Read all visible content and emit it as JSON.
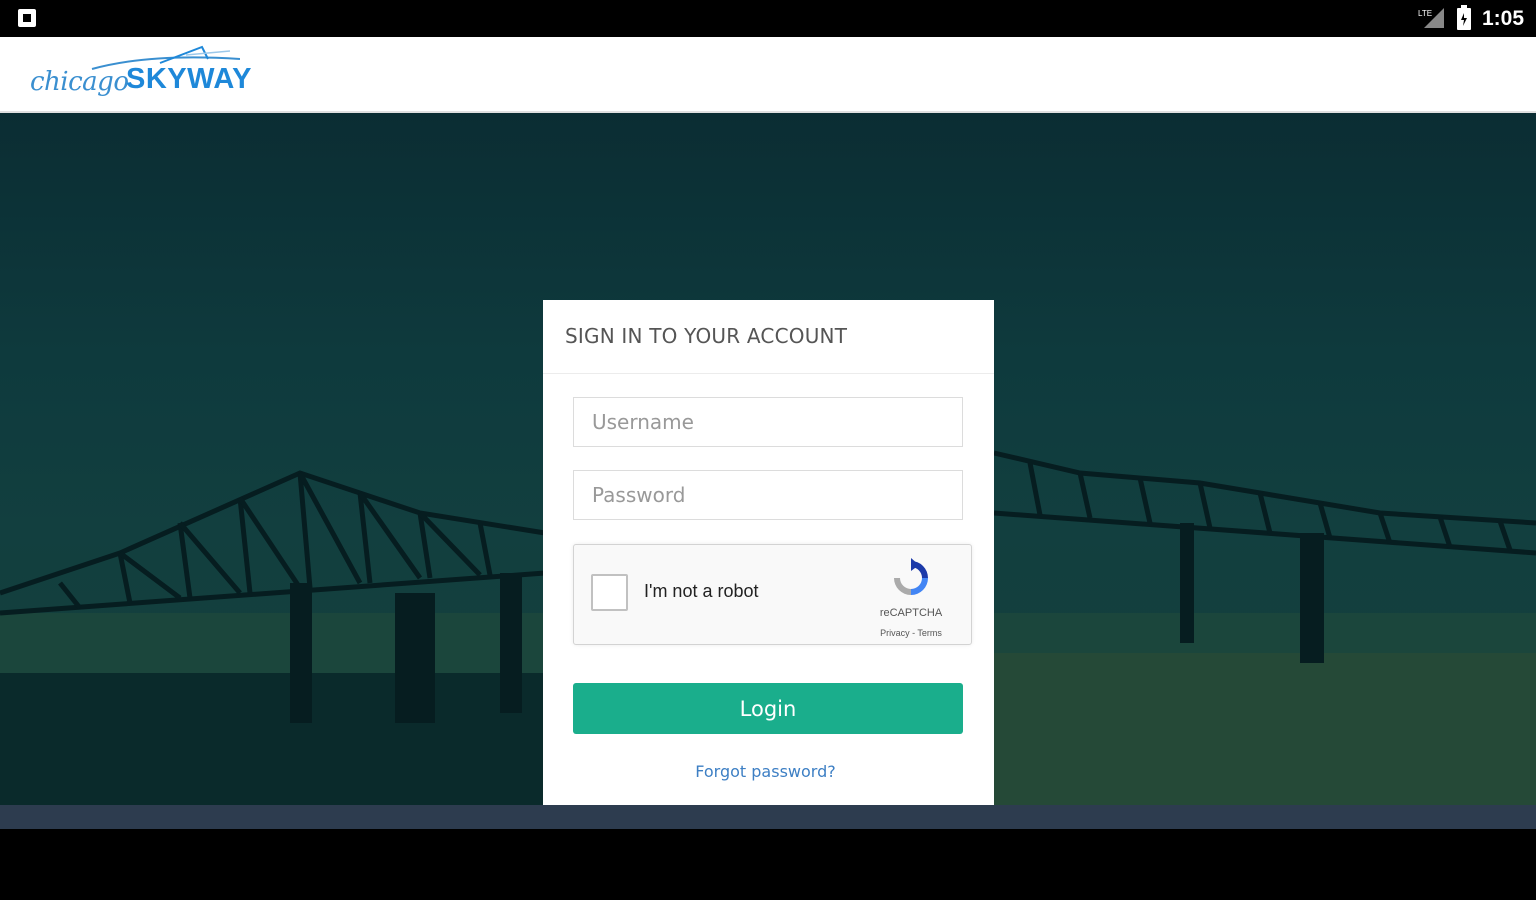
{
  "status_bar": {
    "time": "1:05",
    "left_icon": "notification-icon",
    "signal_icon": "cell-signal-icon",
    "battery_icon": "battery-icon"
  },
  "header": {
    "logo_script": "chicago",
    "logo_bold": "SKYWAY"
  },
  "login": {
    "title": "SIGN IN TO YOUR ACCOUNT",
    "username_placeholder": "Username",
    "password_placeholder": "Password",
    "captcha_label": "I'm not a robot",
    "captcha_brand": "reCAPTCHA",
    "captcha_links": "Privacy - Terms",
    "login_button": "Login",
    "forgot_link": "Forgot password?"
  },
  "colors": {
    "accent": "#1aae8c",
    "link": "#3d7fc4",
    "brand": "#1e88d9",
    "hero": "#0e3a3d"
  }
}
